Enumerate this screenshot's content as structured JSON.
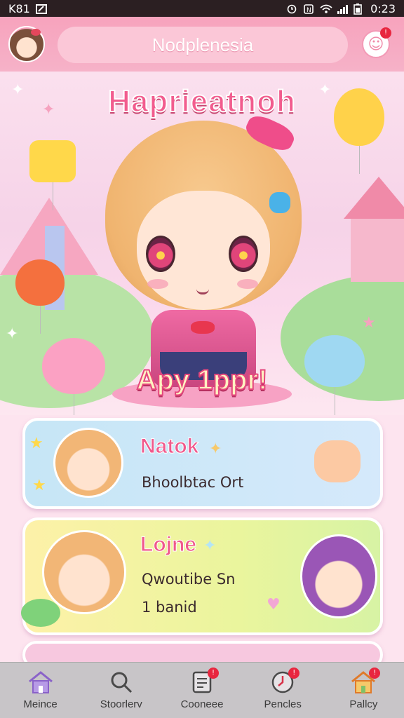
{
  "status_bar": {
    "carrier": "K81",
    "time": "0:23"
  },
  "header": {
    "title": "Nodplenesia",
    "notification_count": "!"
  },
  "hero": {
    "title": "Haprieatnoh",
    "subtitle": "Apy 1ppr!"
  },
  "cards": [
    {
      "title": "Natok",
      "line1": "Bhoolbtac Ort"
    },
    {
      "title": "Lojne",
      "line1": "Qwoutibe Sn",
      "line2": "1 banid"
    },
    {
      "title": ""
    }
  ],
  "bottom_nav": [
    {
      "label": "Meince",
      "icon": "home-icon"
    },
    {
      "label": "Stoorlerv",
      "icon": "search-icon"
    },
    {
      "label": "Cooneee",
      "icon": "messages-icon",
      "badge": "!"
    },
    {
      "label": "Pencles",
      "icon": "clock-icon",
      "badge": "!"
    },
    {
      "label": "Pallcy",
      "icon": "house-icon",
      "badge": "!"
    }
  ],
  "colors": {
    "accent": "#f25c8e",
    "header": "#f7a3bd",
    "nav": "#c8c5c8"
  }
}
